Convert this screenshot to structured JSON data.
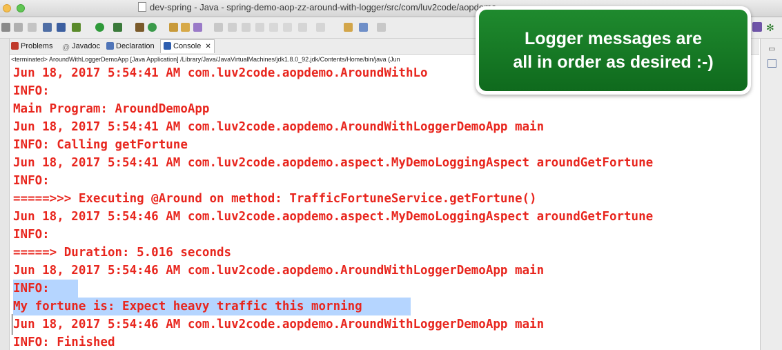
{
  "window": {
    "title": "dev-spring - Java - spring-demo-aop-zz-around-with-logger/src/com/luv2code/aopdemo"
  },
  "tabs": [
    {
      "label": "Problems",
      "icon": "problems-icon",
      "color": "#c0392b"
    },
    {
      "label": "Javadoc",
      "icon": "at-icon",
      "color": "#7f7f7f"
    },
    {
      "label": "Declaration",
      "icon": "declaration-icon",
      "color": "#4f74b8"
    },
    {
      "label": "Console",
      "icon": "console-icon",
      "color": "#2f5fb0",
      "active": true
    }
  ],
  "console": {
    "status": "<terminated> AroundWithLoggerDemoApp [Java Application] /Library/Java/JavaVirtualMachines/jdk1.8.0_92.jdk/Contents/Home/bin/java (Jun",
    "lines": [
      "Jun 18, 2017 5:54:41 AM com.luv2code.aopdemo.AroundWithLo",
      "INFO:",
      "Main Program: AroundDemoApp",
      "Jun 18, 2017 5:54:41 AM com.luv2code.aopdemo.AroundWithLoggerDemoApp main",
      "INFO: Calling getFortune",
      "Jun 18, 2017 5:54:41 AM com.luv2code.aopdemo.aspect.MyDemoLoggingAspect aroundGetFortune",
      "INFO:",
      "=====>>> Executing @Around on method: TrafficFortuneService.getFortune()",
      "Jun 18, 2017 5:54:46 AM com.luv2code.aopdemo.aspect.MyDemoLoggingAspect aroundGetFortune",
      "INFO:",
      "=====> Duration: 5.016 seconds",
      "Jun 18, 2017 5:54:46 AM com.luv2code.aopdemo.AroundWithLoggerDemoApp main",
      "INFO:",
      "My fortune is: Expect heavy traffic this morning",
      "Jun 18, 2017 5:54:46 AM com.luv2code.aopdemo.AroundWithLoggerDemoApp main",
      "INFO: Finished"
    ],
    "text_color": "#e8261e",
    "selection_color": "#b5d5ff"
  },
  "callout": {
    "line1": "Logger messages are",
    "line2": "all in order as desired :-)",
    "color": "#17792a"
  }
}
